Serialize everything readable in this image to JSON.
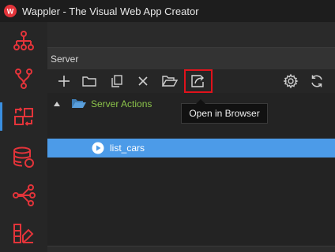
{
  "window": {
    "title": "Wappler - The Visual Web App Creator",
    "brand_color": "#e3343a"
  },
  "activity_bar": {
    "items": [
      {
        "icon": "sitemap-icon",
        "active": false
      },
      {
        "icon": "git-branch-icon",
        "active": false
      },
      {
        "icon": "swap-data-icon",
        "active": true
      },
      {
        "icon": "database-icon",
        "active": false
      },
      {
        "icon": "share-nodes-icon",
        "active": false
      },
      {
        "icon": "design-tools-icon",
        "active": false
      }
    ],
    "accent_color": "#e3343a"
  },
  "panel": {
    "title": "Server",
    "toolbar": {
      "buttons": [
        {
          "icon": "plus-icon",
          "tooltip": ""
        },
        {
          "icon": "folder-icon",
          "tooltip": ""
        },
        {
          "icon": "copy-icon",
          "tooltip": ""
        },
        {
          "icon": "close-icon",
          "tooltip": ""
        },
        {
          "icon": "folder-open-icon",
          "tooltip": ""
        },
        {
          "icon": "open-in-browser-icon",
          "tooltip": "Open in Browser",
          "highlighted": true
        },
        {
          "icon": "gear-icon",
          "tooltip": ""
        },
        {
          "icon": "refresh-icon",
          "tooltip": ""
        }
      ]
    },
    "tree": {
      "folder": {
        "label": "Server Actions",
        "expanded": true
      },
      "items": [
        {
          "label": "list_cars",
          "selected": true
        }
      ]
    }
  },
  "tooltip": {
    "text": "Open in Browser"
  }
}
